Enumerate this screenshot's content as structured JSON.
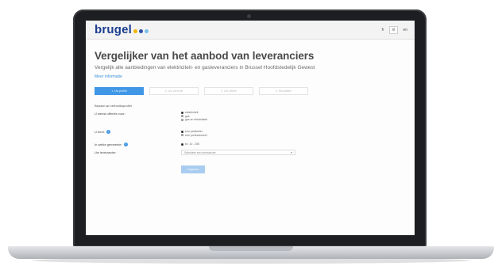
{
  "header": {
    "logo_text": "brugel",
    "logo_dots": [
      "#f2b705",
      "#2c4fa3",
      "#79c0ea"
    ],
    "tools": [
      "fr",
      "nl",
      "en"
    ]
  },
  "page": {
    "title": "Vergelijker van het aanbod van leveranciers",
    "subtitle": "Vergelijk alle aanbiedingen van elektriciteit- en gasleveranciers in Brussel Hoofdstedelijk Gewest",
    "link": "Meer informatie"
  },
  "steps": [
    {
      "label": "1. Uw profiel",
      "active": true
    },
    {
      "label": "2. Uw verbruik",
      "active": false
    },
    {
      "label": "3. Uw offerte",
      "active": false
    },
    {
      "label": "4. Resultaten",
      "active": false
    }
  ],
  "form": {
    "heading": "Bepaal uw verbruiksprofiel",
    "q_energy": "U wenst offertes voor:",
    "energy_options": [
      "elektriciteit",
      "gas",
      "gas en elektriciteit"
    ],
    "q_you": "U bent:",
    "you_options": [
      "een particulier",
      "een professioneel"
    ],
    "q_postcode": "In welke gemeente:",
    "postcode_value": "bv. 10 - 250",
    "q_supplier": "Uw leverancier:",
    "supplier_placeholder": "Selecteer een leverancier",
    "next_label": "Volgende"
  },
  "colors": {
    "brand_blue": "#1a3d8f",
    "accent": "#3f97e6"
  }
}
